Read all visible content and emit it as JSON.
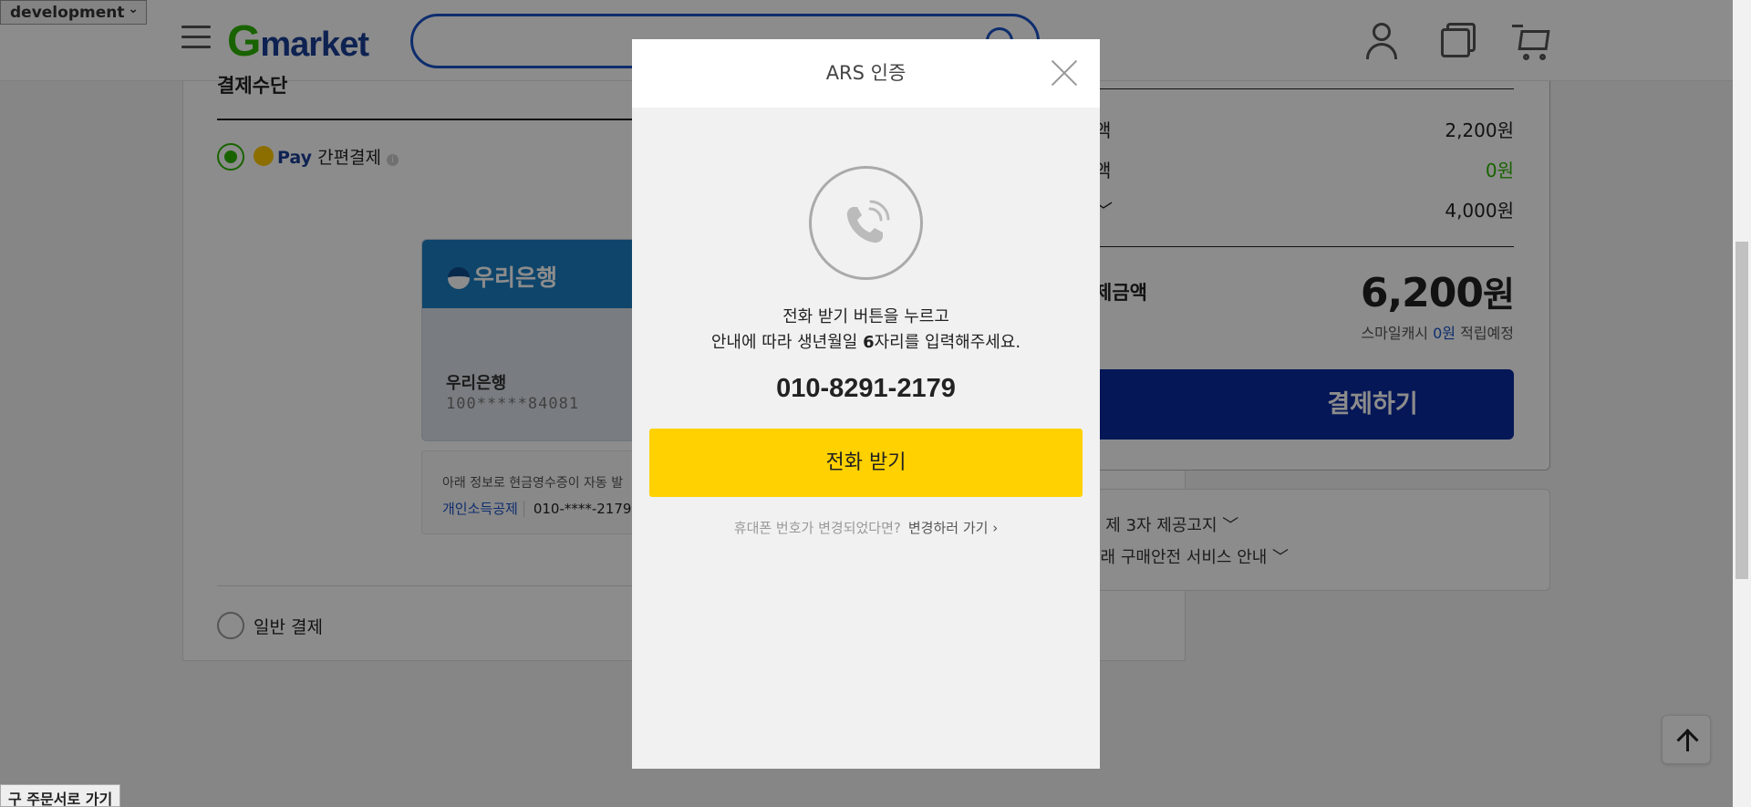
{
  "env_select": {
    "value": "development"
  },
  "header": {
    "logo_g": "G",
    "logo_text": "market",
    "search_placeholder": ""
  },
  "payment": {
    "section_title": "결제수단",
    "smile_pay_label": "Pay",
    "smile_pay_text": "간편결제",
    "card": {
      "bank_logo_text": "우리은행",
      "bank_name": "우리은행",
      "account_masked": "100*****84081"
    },
    "receipt_notice": "아래 정보로 현금영수증이 자동 발",
    "receipt_type": "개인소득공제",
    "receipt_phone": "010-****-2179",
    "general_pay_label": "일반 결제"
  },
  "summary": {
    "rows": [
      {
        "label": "액",
        "value": "2,200원"
      },
      {
        "label": "액",
        "value": "0원"
      },
      {
        "label": "﹀",
        "value": "4,000원"
      }
    ],
    "total_label": "제금액",
    "total_value": "6,200",
    "total_unit": "원",
    "smile_cash_prefix": "스마일캐시",
    "smile_cash_amount": "0원",
    "smile_cash_suffix": "적립예정",
    "pay_button": "결제하기",
    "notices": [
      "로 제 3자 제공고지 ﹀",
      "거래 구매안전 서비스 안내 ﹀"
    ]
  },
  "side_link": "구 주문서로 가기",
  "modal": {
    "title": "ARS 인증",
    "message_line1": "전화 받기 버튼을 누르고",
    "message_line2_pre": "안내에 따라 생년월일 ",
    "message_line2_bold": "6",
    "message_line2_post": "자리를 입력해주세요.",
    "phone_number": "010-8291-2179",
    "call_button": "전화 받기",
    "change_question": "휴대폰 번호가 변경되었다면?",
    "change_link": "변경하러 가기 ›"
  },
  "colors": {
    "accent_green": "#2db400",
    "brand_blue": "#1a3e96",
    "pay_button": "#0a2a9e",
    "call_button": "#ffd100"
  },
  "icons": [
    "hamburger-icon",
    "search-icon",
    "user-icon",
    "orders-icon",
    "cart-icon",
    "close-icon",
    "phone-icon",
    "arrow-up-icon"
  ]
}
